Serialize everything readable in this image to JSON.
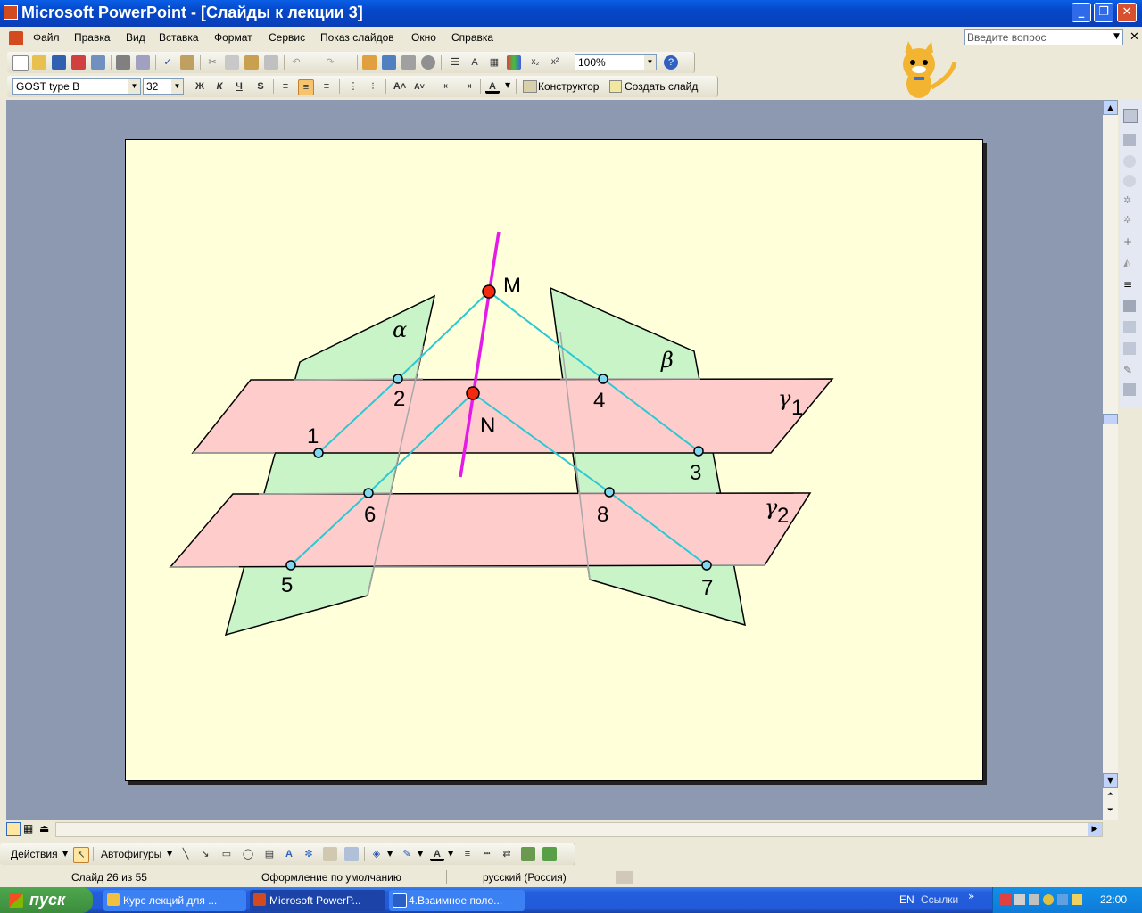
{
  "window": {
    "title": "Microsoft PowerPoint - [Слайды к лекции 3]"
  },
  "menu": {
    "items": [
      "Файл",
      "Правка",
      "Вид",
      "Вставка",
      "Формат",
      "Сервис",
      "Показ слайдов",
      "Окно",
      "Справка"
    ],
    "ask_placeholder": "Введите вопрос"
  },
  "toolbar_standard": {
    "zoom": "100%"
  },
  "toolbar_formatting": {
    "font": "GOST type B",
    "size": "32",
    "bold": "Ж",
    "italic": "К",
    "underline": "Ч",
    "shadow": "S",
    "designer": "Конструктор",
    "new_slide": "Создать слайд"
  },
  "slide": {
    "labels": {
      "M": "M",
      "N": "N",
      "p1": "1",
      "p2": "2",
      "p3": "3",
      "p4": "4",
      "p5": "5",
      "p6": "6",
      "p7": "7",
      "p8": "8",
      "alpha": "α",
      "beta": "β",
      "gamma": "γ",
      "gamma1_sub": "1",
      "gamma2_sub": "2"
    }
  },
  "drawing_toolbar": {
    "actions": "Действия",
    "autoshapes": "Автофигуры"
  },
  "status": {
    "slide": "Слайд 26 из 55",
    "design": "Оформление по умолчанию",
    "language": "русский (Россия)"
  },
  "taskbar": {
    "start": "пуск",
    "tasks": [
      "Курс лекций для ...",
      "Microsoft PowerP...",
      "4.Взаимное поло..."
    ],
    "lang": "EN",
    "links": "Ссылки",
    "clock": "22:00"
  }
}
